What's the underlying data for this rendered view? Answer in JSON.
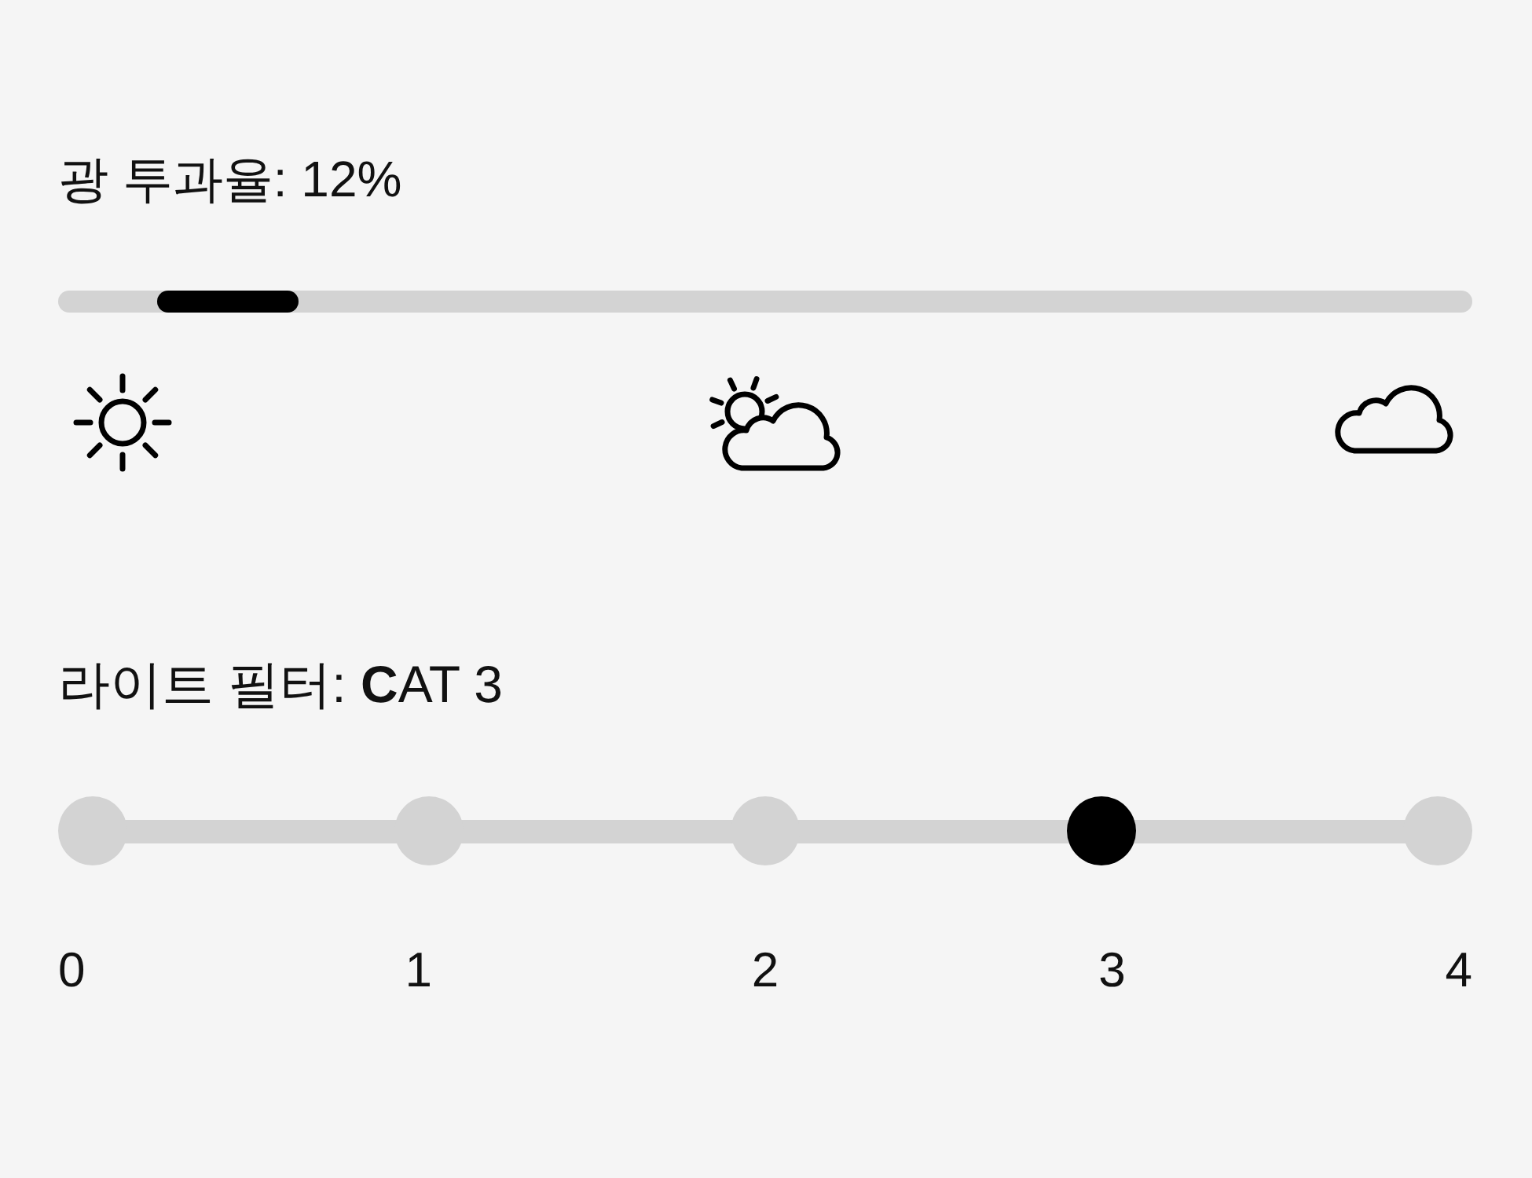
{
  "light_transmission": {
    "label": "광 투과율: 12%",
    "level": 0.12
  },
  "light_filter": {
    "label": "라이트 필터: **C**AT 3",
    "steps": [
      {
        "label": "0",
        "selected": false
      },
      {
        "label": "1",
        "selected": false
      },
      {
        "label": "2",
        "selected": false
      },
      {
        "label": "3",
        "selected": true
      },
      {
        "label": "4",
        "selected": false
      }
    ]
  }
}
